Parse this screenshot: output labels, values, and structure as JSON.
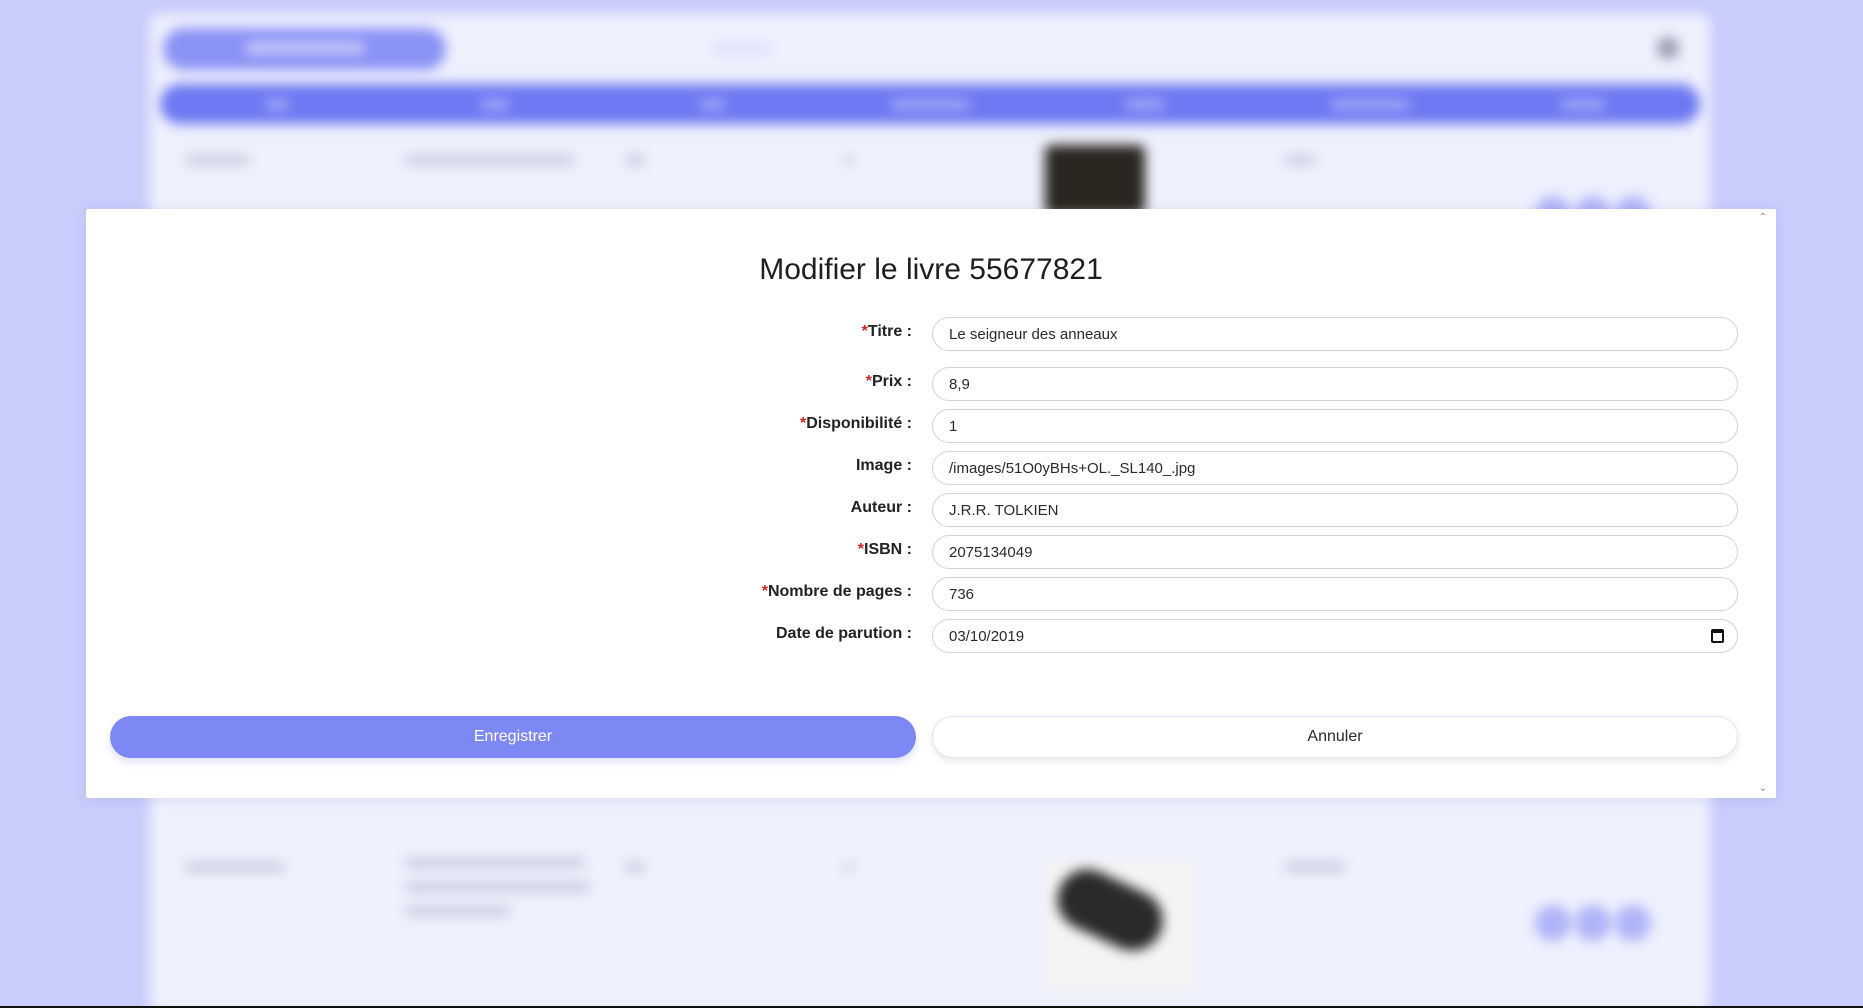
{
  "modal": {
    "title": "Modifier le livre 55677821",
    "required_marker": "*",
    "fields": {
      "titre": {
        "label": "Titre :",
        "required": true,
        "value": "Le seigneur des anneaux"
      },
      "prix": {
        "label": "Prix :",
        "required": true,
        "value": "8,9"
      },
      "disponibilite": {
        "label": "Disponibilité :",
        "required": true,
        "value": "1"
      },
      "image": {
        "label": "Image :",
        "required": false,
        "value": "/images/51O0yBHs+OL._SL140_.jpg"
      },
      "auteur": {
        "label": "Auteur :",
        "required": false,
        "value": "J.R.R. TOLKIEN"
      },
      "isbn": {
        "label": "ISBN :",
        "required": true,
        "value": "2075134049"
      },
      "nombre_pages": {
        "label": "Nombre de pages :",
        "required": true,
        "value": "736"
      },
      "date_parution": {
        "label": "Date de parution :",
        "required": false,
        "value": "03/10/2019"
      }
    },
    "save_label": "Enregistrer",
    "cancel_label": "Annuler"
  },
  "colors": {
    "primary": "#7e88f4",
    "background": "#c9cdfb",
    "required": "#d62222"
  },
  "icons": {
    "calendar": "calendar-icon",
    "scroll_up": "chevron-up-icon",
    "scroll_down": "chevron-down-icon"
  }
}
